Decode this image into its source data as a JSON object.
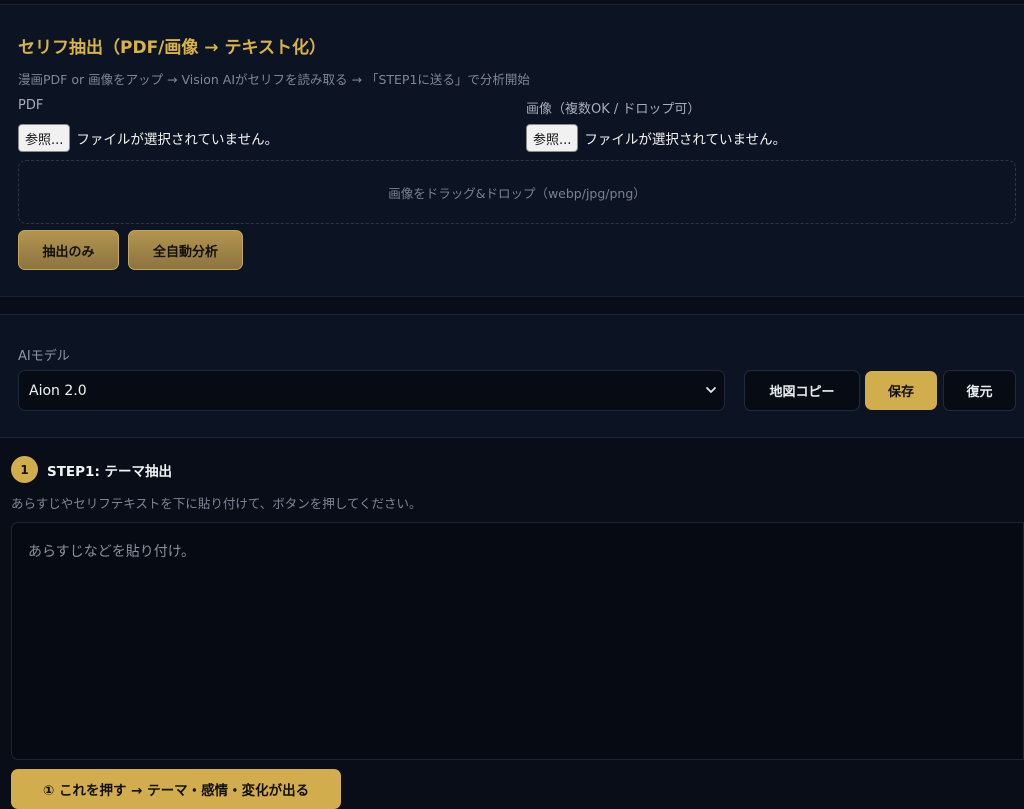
{
  "extract": {
    "title": "セリフ抽出（PDF/画像 → テキスト化）",
    "description": "漫画PDF or 画像をアップ → Vision AIがセリフを読み取る → 「STEP1に送る」で分析開始",
    "pdf": {
      "label": "PDF",
      "browse_label": "参照...",
      "status": "ファイルが選択されていません。"
    },
    "image": {
      "label": "画像（複数OK / ドロップ可）",
      "browse_label": "参照...",
      "status": "ファイルが選択されていません。"
    },
    "dropzone_text": "画像をドラッグ&ドロップ（webp/jpg/png）",
    "extract_only_label": "抽出のみ",
    "full_auto_label": "全自動分析"
  },
  "model": {
    "label": "AIモデル",
    "selected": "Aion 2.0",
    "copy_map_label": "地図コピー",
    "save_label": "保存",
    "restore_label": "復元"
  },
  "step1": {
    "number": "1",
    "title": "STEP1: テーマ抽出",
    "description": "あらすじやセリフテキストを下に貼り付けて、ボタンを押してください。",
    "placeholder": "あらすじなどを貼り付け。",
    "run_label": "① これを押す → テーマ・感情・変化が出る"
  },
  "colors": {
    "accent_gold": "#d2ad4d",
    "background": "#080d18",
    "panel": "#0c1322"
  }
}
